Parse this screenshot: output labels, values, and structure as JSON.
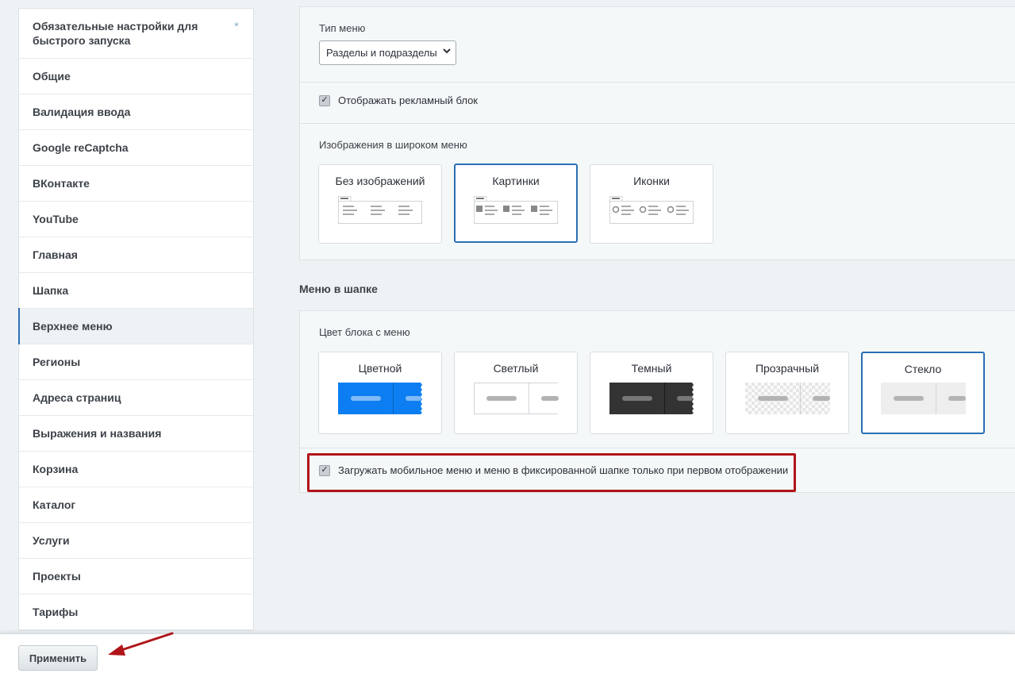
{
  "sidebar": {
    "items": [
      {
        "label": "Обязательные настройки для быстрого запуска",
        "star": "*"
      },
      {
        "label": "Общие"
      },
      {
        "label": "Валидация ввода"
      },
      {
        "label": "Google reCaptcha"
      },
      {
        "label": "ВКонтакте"
      },
      {
        "label": "YouTube"
      },
      {
        "label": "Главная"
      },
      {
        "label": "Шапка"
      },
      {
        "label": "Верхнее меню"
      },
      {
        "label": "Регионы"
      },
      {
        "label": "Адреса страниц"
      },
      {
        "label": "Выражения и названия"
      },
      {
        "label": "Корзина"
      },
      {
        "label": "Каталог"
      },
      {
        "label": "Услуги"
      },
      {
        "label": "Проекты"
      },
      {
        "label": "Тарифы"
      }
    ],
    "active_index": 8
  },
  "menu_type": {
    "label": "Тип меню",
    "selected": "Разделы и подразделы"
  },
  "ad_block": {
    "label": "Отображать рекламный блок",
    "checked": true
  },
  "wide_menu_images": {
    "label": "Изображения в широком меню",
    "options": [
      {
        "title": "Без изображений",
        "selected": false
      },
      {
        "title": "Картинки",
        "selected": true
      },
      {
        "title": "Иконки",
        "selected": false
      }
    ]
  },
  "header_menu": {
    "heading": "Меню в шапке",
    "color_label": "Цвет блока с меню",
    "options": [
      {
        "title": "Цветной",
        "selected": false,
        "color": "#0d7ef1"
      },
      {
        "title": "Светлый",
        "selected": false,
        "color": "#ffffff"
      },
      {
        "title": "Темный",
        "selected": false,
        "color": "#333333"
      },
      {
        "title": "Прозрачный",
        "selected": false,
        "color": "transparent"
      },
      {
        "title": "Стекло",
        "selected": true,
        "color": "#eeeeee"
      }
    ],
    "lazy_load": {
      "label": "Загружать мобильное меню и меню в фиксированной шапке только при первом отображении",
      "checked": true
    }
  },
  "footer": {
    "apply_label": "Применить"
  },
  "colors": {
    "accent": "#2a6fb4",
    "highlight": "#b0141a",
    "brand_blue": "#0d7ef1"
  }
}
